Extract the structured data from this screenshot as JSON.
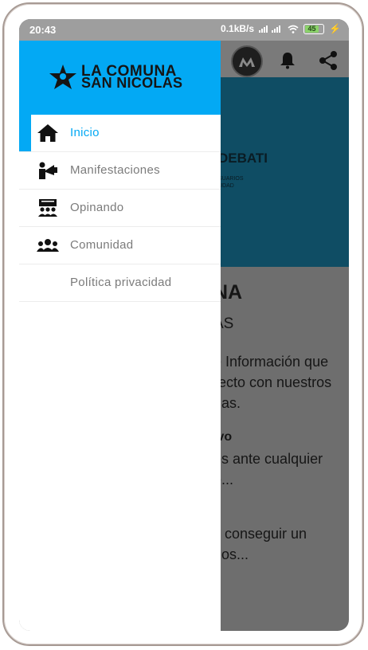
{
  "status_bar": {
    "time": "20:43",
    "network_speed": "0.1kB/s",
    "battery_level": "45"
  },
  "app_bar": {
    "logo_icon": "app-logo-icon",
    "notification_icon": "bell-icon",
    "share_icon": "share-icon"
  },
  "background": {
    "banner_title": "DEBATI",
    "banner_sub_1": "SUARIOS",
    "banner_sub_2": "UDAD",
    "heading_1": "NA",
    "heading_2": "AS",
    "para_1_line_1": "e Información que",
    "para_1_line_2": "recto con nuestros",
    "para_1_line_3": "nas.",
    "section_2_title": "ivo",
    "section_2_line_1": "os ante cualquier",
    "section_2_line_2": "e...",
    "section_3_title": "a",
    "section_3_line_1": "y conseguir un",
    "section_3_line_2": "dos..."
  },
  "drawer": {
    "brand_line_1": "LA COMUNA",
    "brand_line_2": "SAN NICOLAS",
    "items": [
      {
        "label": "Inicio",
        "icon": "home-icon",
        "active": true
      },
      {
        "label": "Manifestaciones",
        "icon": "megaphone-icon",
        "active": false
      },
      {
        "label": "Opinando",
        "icon": "presentation-icon",
        "active": false
      },
      {
        "label": "Comunidad",
        "icon": "group-icon",
        "active": false
      },
      {
        "label": "Política privacidad",
        "icon": "",
        "active": false
      }
    ]
  },
  "colors": {
    "accent": "#03a9f4",
    "banner": "#0f4d64",
    "overlay": "#6e6e6e"
  }
}
